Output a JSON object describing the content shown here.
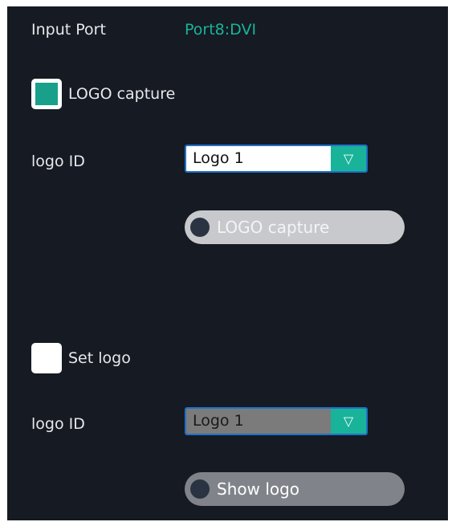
{
  "input_port": {
    "label": "Input Port",
    "value": "Port8:DVI"
  },
  "logo_capture": {
    "checkbox_label": "LOGO capture",
    "checked": true,
    "logo_id_label": "logo ID",
    "logo_id_value": "Logo 1",
    "dropdown_arrow": "▽",
    "button_label": "LOGO capture"
  },
  "set_logo": {
    "checkbox_label": "Set logo",
    "checked": false,
    "logo_id_label": "logo ID",
    "logo_id_value": "Logo 1",
    "dropdown_arrow": "▽",
    "button_label": "Show logo"
  },
  "colors": {
    "panel_bg": "#161a22",
    "accent": "#19b39a"
  }
}
